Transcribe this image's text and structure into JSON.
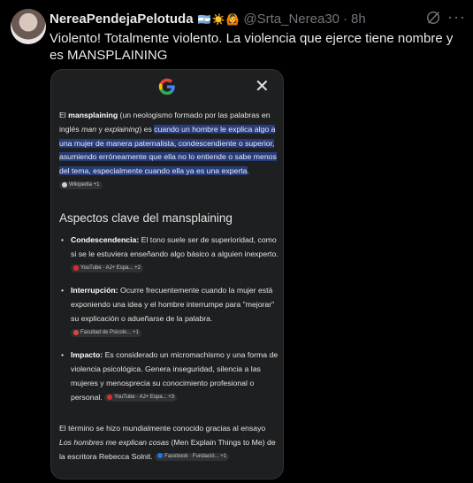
{
  "post": {
    "display_name": "NereaPendejaPelotuda",
    "emojis": "🇦🇷☀️🙆",
    "handle": "@Srta_Nerea30",
    "separator": "·",
    "time": "8h",
    "more_label": "···",
    "text": "Violento! Totalmente violento. La violencia que ejerce tiene nombre y es MANSPLAINING"
  },
  "card": {
    "close_label": "✕",
    "definition": {
      "prefix": "El ",
      "term": "mansplaining",
      "middle1": " (un neologismo formado por las palabras en inglés ",
      "word_man": "man",
      "middle2": " y ",
      "word_explaining": "explaining",
      "middle3": ") es ",
      "highlight": "cuando un hombre le explica algo a una mujer de manera paternalista, condescendiente o superior, asumiendo erróneamente que ella no lo entiende o sabe menos del tema, especialmente cuando ella ya es una experta",
      "suffix": ".",
      "source": "Wikipedia +1"
    },
    "section_title": "Aspectos clave del mansplaining",
    "bullets": [
      {
        "label": "Condescendencia:",
        "text": " El tono suele ser de superioridad, como si se le estuviera enseñando algo básico a alguien inexperto.",
        "source": "YouTube · AJ+ Espa... +2"
      },
      {
        "label": "Interrupción:",
        "text": " Ocurre frecuentemente cuando la mujer está exponiendo una idea y el hombre interrumpe para \"mejorar\" su explicación o adueñarse de la palabra.",
        "source": "Facultad de Psicolo... +1"
      },
      {
        "label": "Impacto:",
        "text": " Es considerado un micromachismo y una forma de violencia psicológica. Genera inseguridad, silencia a las mujeres y menosprecia su conocimiento profesional o personal.",
        "source": "YouTube · AJ+ Espa... +3"
      }
    ],
    "closing": {
      "text1": "El término se hizo mundialmente conocido gracias al ensayo ",
      "book": "Los hombres me explican cosas",
      "text2": " (Men Explain Things to Me) de la escritora Rebecca Solnit.",
      "source": "Facebook · Fundació... +1"
    }
  },
  "icons": {
    "avatar": "avatar",
    "grok": "grok-icon",
    "google": "google-logo-icon",
    "close": "close-icon",
    "wikipedia": "wikipedia-icon",
    "youtube": "youtube-icon",
    "facebook": "facebook-icon"
  },
  "colors": {
    "background": "#000000",
    "card": "#1e1f20",
    "highlight": "#283c77",
    "muted": "#71767b",
    "text": "#e7e9ea"
  }
}
